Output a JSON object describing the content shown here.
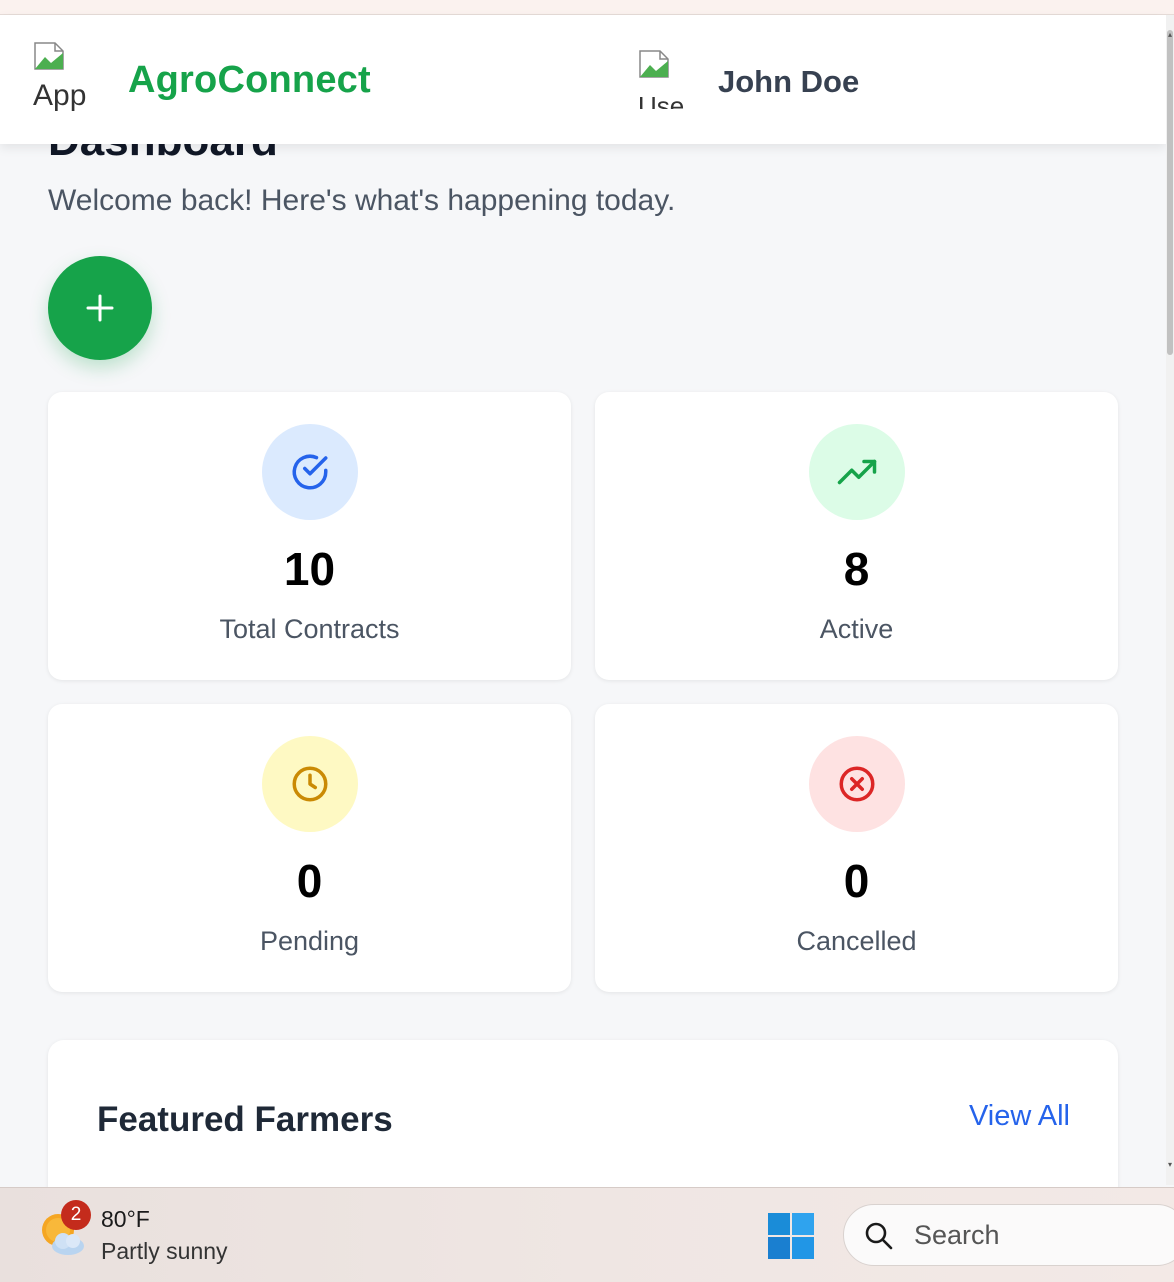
{
  "header": {
    "logo_alt": "App",
    "brand": "AgroConnect",
    "avatar_alt": "Use",
    "user_name": "John Doe"
  },
  "page": {
    "title": "Dashboard",
    "subtitle": "Welcome back! Here's what's happening today.",
    "add_icon": "plus-icon"
  },
  "stats": [
    {
      "value": "10",
      "label": "Total Contracts",
      "icon": "check-circle-icon",
      "color": "#2563eb",
      "bg": "#dbeafe"
    },
    {
      "value": "8",
      "label": "Active",
      "icon": "trending-up-icon",
      "color": "#16a34a",
      "bg": "#dcfce7"
    },
    {
      "value": "0",
      "label": "Pending",
      "icon": "clock-icon",
      "color": "#ca8a04",
      "bg": "#fef9c3"
    },
    {
      "value": "0",
      "label": "Cancelled",
      "icon": "x-circle-icon",
      "color": "#dc2626",
      "bg": "#fee2e2"
    }
  ],
  "featured": {
    "title": "Featured Farmers",
    "view_all": "View All"
  },
  "taskbar": {
    "weather_badge": "2",
    "temperature": "80°F",
    "condition": "Partly sunny",
    "search_placeholder": "Search"
  },
  "colors": {
    "brand": "#16a34a",
    "link": "#2563eb"
  }
}
